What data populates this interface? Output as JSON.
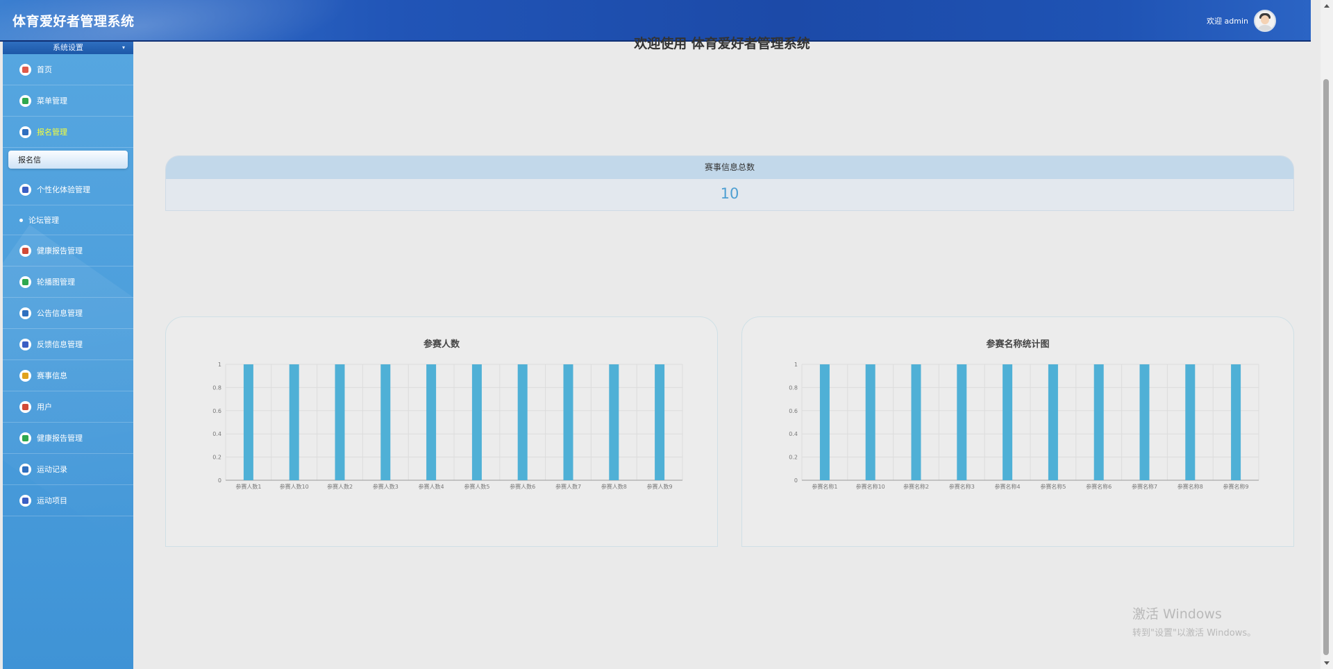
{
  "header": {
    "title": "体育爱好者管理系统",
    "welcome": "欢迎 admin"
  },
  "sidebar": {
    "section_label": "系统设置",
    "items": [
      {
        "label": "首页",
        "icon": "home-icon",
        "color": "#e05a4b"
      },
      {
        "label": "菜单管理",
        "icon": "menu-icon",
        "color": "#2fa84f"
      },
      {
        "label": "报名管理",
        "icon": "signup-icon",
        "color": "#2f6fbf",
        "active": true
      },
      {
        "label": "报名信",
        "sub": true
      },
      {
        "label": "个性化体验管理",
        "icon": "experience-icon",
        "color": "#3b5fc4"
      },
      {
        "label": "论坛管理",
        "dot": true
      },
      {
        "label": "健康报告管理",
        "icon": "briefcase-icon",
        "color": "#d24a37"
      },
      {
        "label": "轮播图管理",
        "icon": "image-icon",
        "color": "#2fa84f"
      },
      {
        "label": "公告信息管理",
        "icon": "notice-icon",
        "color": "#2f6fbf"
      },
      {
        "label": "反馈信息管理",
        "icon": "feedback-icon",
        "color": "#3b5fc4"
      },
      {
        "label": "赛事信息",
        "icon": "event-icon",
        "color": "#e0a21d"
      },
      {
        "label": "用户",
        "icon": "user-icon",
        "color": "#d24a37"
      },
      {
        "label": "健康报告管理",
        "icon": "report-icon",
        "color": "#2fa84f"
      },
      {
        "label": "运动记录",
        "icon": "record-icon",
        "color": "#2f6fbf"
      },
      {
        "label": "运动项目",
        "icon": "sport-icon",
        "color": "#3b5fc4"
      }
    ]
  },
  "main": {
    "welcome_text": "欢迎使用 体育爱好者管理系统",
    "stat": {
      "title": "赛事信息总数",
      "value": "10"
    }
  },
  "chart_data": [
    {
      "type": "bar",
      "title": "参赛人数",
      "categories": [
        "参赛人数1",
        "参赛人数10",
        "参赛人数2",
        "参赛人数3",
        "参赛人数4",
        "参赛人数5",
        "参赛人数6",
        "参赛人数7",
        "参赛人数8",
        "参赛人数9"
      ],
      "values": [
        1,
        1,
        1,
        1,
        1,
        1,
        1,
        1,
        1,
        1
      ],
      "ylim": [
        0,
        1
      ],
      "yticks": [
        "0",
        "0.2",
        "0.4",
        "0.6",
        "0.8",
        "1"
      ],
      "color": "#4fb0d6",
      "grid": true
    },
    {
      "type": "bar",
      "title": "参赛名称统计图",
      "categories": [
        "参赛名称1",
        "参赛名称10",
        "参赛名称2",
        "参赛名称3",
        "参赛名称4",
        "参赛名称5",
        "参赛名称6",
        "参赛名称7",
        "参赛名称8",
        "参赛名称9"
      ],
      "values": [
        1,
        1,
        1,
        1,
        1,
        1,
        1,
        1,
        1,
        1
      ],
      "ylim": [
        0,
        1
      ],
      "yticks": [
        "0",
        "0.2",
        "0.4",
        "0.6",
        "0.8",
        "1"
      ],
      "color": "#4fb0d6",
      "grid": true
    }
  ],
  "watermark": {
    "line1": "激活 Windows",
    "line2": "转到\"设置\"以激活 Windows。"
  }
}
